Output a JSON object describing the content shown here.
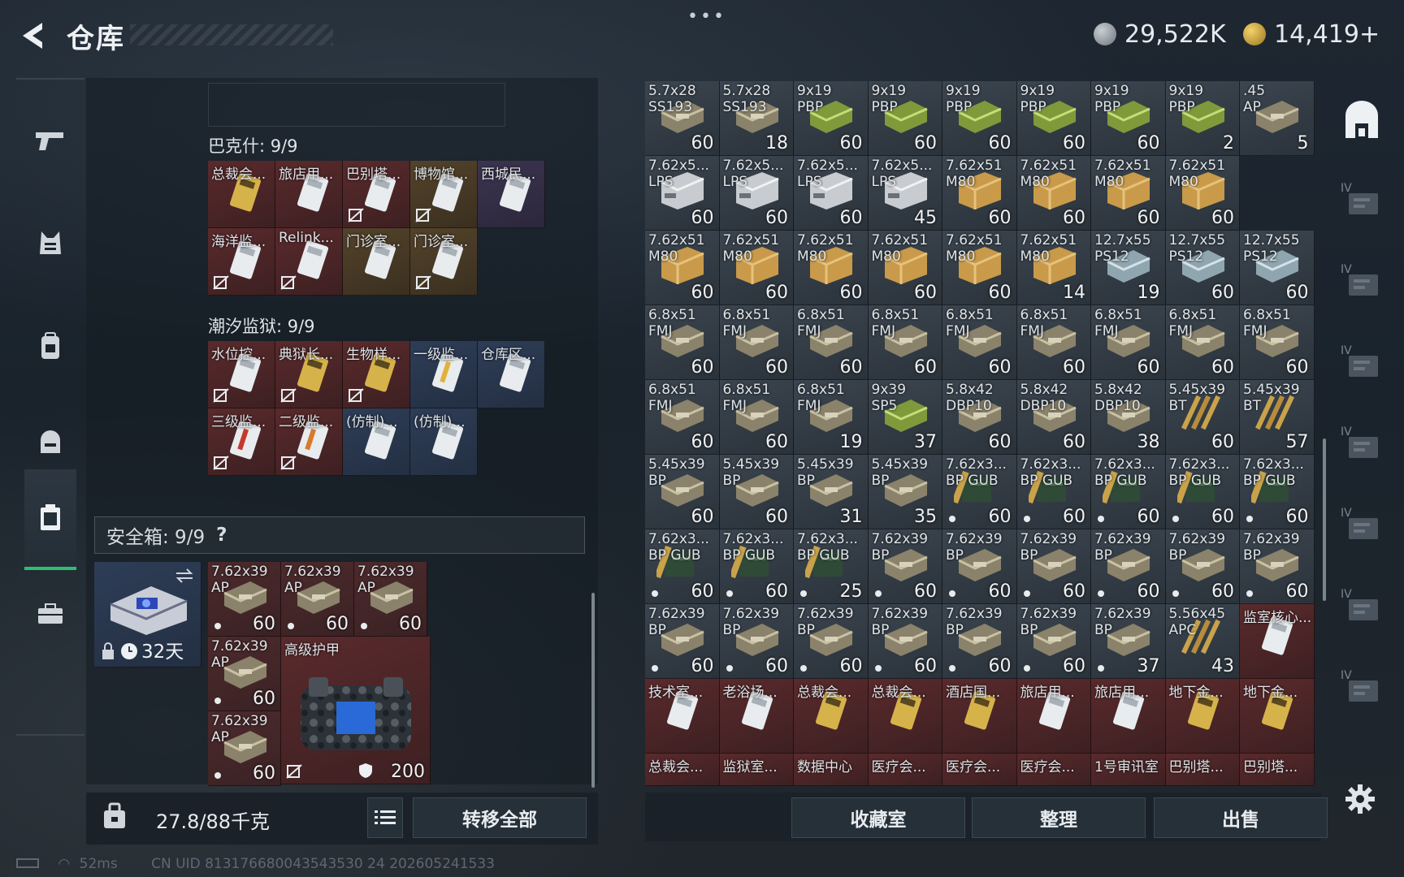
{
  "header": {
    "title": "仓库",
    "more": "•••"
  },
  "currency": {
    "silver": "29,522K",
    "gold": "14,419+"
  },
  "colors": {
    "accent": "#2fbf71",
    "rarity_gray": "#3c4650",
    "rarity_blue": "#2e3d57",
    "rarity_purple": "#3c3450",
    "rarity_red": "#5a2a2c",
    "rarity_orange": "#54432a"
  },
  "sidebar": {
    "items": [
      {
        "icon": "pistol-icon"
      },
      {
        "icon": "armor-vest-icon"
      },
      {
        "icon": "backpack-icon"
      },
      {
        "icon": "helmet-bag-icon"
      },
      {
        "icon": "safe-box-icon",
        "active": true
      },
      {
        "icon": "briefcase-icon"
      }
    ]
  },
  "keyring": {
    "group1": {
      "label": "巴克什: 9/9",
      "items": [
        {
          "name": "总裁会...",
          "rarity": "r",
          "card": "gold",
          "lock": false
        },
        {
          "name": "旅店用...",
          "rarity": "r",
          "card": "white",
          "lock": false
        },
        {
          "name": "巴别塔...",
          "rarity": "r",
          "card": "white",
          "lock": true
        },
        {
          "name": "博物馆...",
          "rarity": "o",
          "card": "white",
          "lock": true
        },
        {
          "name": "西城民...",
          "rarity": "p",
          "card": "white",
          "lock": false
        },
        {
          "name": "海洋监...",
          "rarity": "r",
          "card": "white",
          "lock": true
        },
        {
          "name": "Relink...",
          "rarity": "r",
          "card": "white",
          "lock": true
        },
        {
          "name": "门诊室...",
          "rarity": "o",
          "card": "white",
          "lock": false
        },
        {
          "name": "门诊室...",
          "rarity": "o",
          "card": "white",
          "lock": true
        }
      ]
    },
    "group2": {
      "label": "潮汐监狱: 9/9",
      "items": [
        {
          "name": "水位控...",
          "rarity": "r",
          "card": "white",
          "lock": true
        },
        {
          "name": "典狱长...",
          "rarity": "r",
          "card": "gold",
          "lock": true
        },
        {
          "name": "生物样...",
          "rarity": "r",
          "card": "gold",
          "lock": true
        },
        {
          "name": "一级监...",
          "rarity": "b",
          "card": "yellowbar",
          "lock": false
        },
        {
          "name": "仓库区...",
          "rarity": "b",
          "card": "white",
          "lock": false
        },
        {
          "name": "三级监...",
          "rarity": "r",
          "card": "redbar",
          "lock": true
        },
        {
          "name": "二级监...",
          "rarity": "r",
          "card": "orangebar",
          "lock": true
        },
        {
          "name": "(仿制)...",
          "rarity": "b",
          "card": "white",
          "lock": false
        },
        {
          "name": "(仿制)...",
          "rarity": "b",
          "card": "white",
          "lock": false
        }
      ]
    }
  },
  "safe": {
    "label": "安全箱: 9/9",
    "help": "?",
    "timer": "32天",
    "ammo": [
      {
        "n1": "7.62x39",
        "n2": "AP",
        "q": "60"
      },
      {
        "n1": "7.62x39",
        "n2": "AP",
        "q": "60"
      },
      {
        "n1": "7.62x39",
        "n2": "AP",
        "q": "60"
      },
      {
        "n1": "7.62x39",
        "n2": "AP",
        "q": "60"
      },
      {
        "n1": "7.62x39",
        "n2": "AP",
        "q": "60"
      }
    ],
    "armor": {
      "name": "高级护甲",
      "durability": "200"
    }
  },
  "bottom": {
    "weight": "27.8/88千克",
    "transfer_all": "转移全部",
    "collection": "收藏室",
    "sort": "整理",
    "sell": "出售"
  },
  "footer": {
    "ping": "52ms",
    "uid": "CN UID 813176680043543530 24 202605241533"
  },
  "stash": [
    [
      {
        "n1": "5.7x28",
        "n2": "SS193",
        "q": "60",
        "c": "g",
        "a": "box"
      },
      {
        "n1": "5.7x28",
        "n2": "SS193",
        "q": "18",
        "c": "g",
        "a": "box"
      },
      {
        "n1": "9x19",
        "n2": "PBP",
        "q": "60",
        "c": "g",
        "a": "greenbox"
      },
      {
        "n1": "9x19",
        "n2": "PBP",
        "q": "60",
        "c": "g",
        "a": "greenbox"
      },
      {
        "n1": "9x19",
        "n2": "PBP",
        "q": "60",
        "c": "g",
        "a": "greenbox"
      },
      {
        "n1": "9x19",
        "n2": "PBP",
        "q": "60",
        "c": "g",
        "a": "greenbox"
      },
      {
        "n1": "9x19",
        "n2": "PBP",
        "q": "60",
        "c": "g",
        "a": "greenbox"
      },
      {
        "n1": "9x19",
        "n2": "PBP",
        "q": "2",
        "c": "g",
        "a": "greenbox"
      },
      {
        "n1": ".45",
        "n2": "AP",
        "q": "5",
        "c": "g",
        "a": "box"
      }
    ],
    [
      {
        "n1": "7.62x5...",
        "n2": "LPS",
        "q": "60",
        "c": "g",
        "a": "whitebox"
      },
      {
        "n1": "7.62x5...",
        "n2": "LPS",
        "q": "60",
        "c": "g",
        "a": "whitebox"
      },
      {
        "n1": "7.62x5...",
        "n2": "LPS",
        "q": "60",
        "c": "g",
        "a": "whitebox"
      },
      {
        "n1": "7.62x5...",
        "n2": "LPS",
        "q": "45",
        "c": "g",
        "a": "whitebox"
      },
      {
        "n1": "7.62x51",
        "n2": "M80",
        "q": "60",
        "c": "g",
        "a": "crate"
      },
      {
        "n1": "7.62x51",
        "n2": "M80",
        "q": "60",
        "c": "g",
        "a": "crate"
      },
      {
        "n1": "7.62x51",
        "n2": "M80",
        "q": "60",
        "c": "g",
        "a": "crate"
      },
      {
        "n1": "7.62x51",
        "n2": "M80",
        "q": "60",
        "c": "g",
        "a": "crate"
      }
    ],
    [
      {
        "n1": "7.62x51",
        "n2": "M80",
        "q": "60",
        "c": "g",
        "a": "crate"
      },
      {
        "n1": "7.62x51",
        "n2": "M80",
        "q": "60",
        "c": "g",
        "a": "crate"
      },
      {
        "n1": "7.62x51",
        "n2": "M80",
        "q": "60",
        "c": "g",
        "a": "crate"
      },
      {
        "n1": "7.62x51",
        "n2": "M80",
        "q": "60",
        "c": "g",
        "a": "crate"
      },
      {
        "n1": "7.62x51",
        "n2": "M80",
        "q": "60",
        "c": "g",
        "a": "crate"
      },
      {
        "n1": "7.62x51",
        "n2": "M80",
        "q": "14",
        "c": "g",
        "a": "crate"
      },
      {
        "n1": "12.7x55",
        "n2": "PS12",
        "q": "19",
        "c": "g",
        "a": "bluebox"
      },
      {
        "n1": "12.7x55",
        "n2": "PS12",
        "q": "60",
        "c": "g",
        "a": "bluebox"
      },
      {
        "n1": "12.7x55",
        "n2": "PS12",
        "q": "60",
        "c": "g",
        "a": "bluebox"
      }
    ],
    [
      {
        "n1": "6.8x51",
        "n2": "FMJ",
        "q": "60",
        "c": "g",
        "a": "box"
      },
      {
        "n1": "6.8x51",
        "n2": "FMJ",
        "q": "60",
        "c": "g",
        "a": "box"
      },
      {
        "n1": "6.8x51",
        "n2": "FMJ",
        "q": "60",
        "c": "g",
        "a": "box"
      },
      {
        "n1": "6.8x51",
        "n2": "FMJ",
        "q": "60",
        "c": "g",
        "a": "box"
      },
      {
        "n1": "6.8x51",
        "n2": "FMJ",
        "q": "60",
        "c": "g",
        "a": "box"
      },
      {
        "n1": "6.8x51",
        "n2": "FMJ",
        "q": "60",
        "c": "g",
        "a": "box"
      },
      {
        "n1": "6.8x51",
        "n2": "FMJ",
        "q": "60",
        "c": "g",
        "a": "box"
      },
      {
        "n1": "6.8x51",
        "n2": "FMJ",
        "q": "60",
        "c": "g",
        "a": "box"
      },
      {
        "n1": "6.8x51",
        "n2": "FMJ",
        "q": "60",
        "c": "g",
        "a": "box"
      }
    ],
    [
      {
        "n1": "6.8x51",
        "n2": "FMJ",
        "q": "60",
        "c": "g",
        "a": "box"
      },
      {
        "n1": "6.8x51",
        "n2": "FMJ",
        "q": "60",
        "c": "g",
        "a": "box"
      },
      {
        "n1": "6.8x51",
        "n2": "FMJ",
        "q": "19",
        "c": "g",
        "a": "box"
      },
      {
        "n1": "9x39",
        "n2": "SP5",
        "q": "37",
        "c": "g",
        "a": "greenbox"
      },
      {
        "n1": "5.8x42",
        "n2": "DBP10",
        "q": "60",
        "c": "g",
        "a": "box"
      },
      {
        "n1": "5.8x42",
        "n2": "DBP10",
        "q": "60",
        "c": "g",
        "a": "box"
      },
      {
        "n1": "5.8x42",
        "n2": "DBP10",
        "q": "38",
        "c": "g",
        "a": "box"
      },
      {
        "n1": "5.45x39",
        "n2": "BT",
        "q": "60",
        "c": "g",
        "a": "rounds"
      },
      {
        "n1": "5.45x39",
        "n2": "BT",
        "q": "57",
        "c": "g",
        "a": "rounds"
      }
    ],
    [
      {
        "n1": "5.45x39",
        "n2": "BP",
        "q": "60",
        "c": "g",
        "a": "box"
      },
      {
        "n1": "5.45x39",
        "n2": "BP",
        "q": "60",
        "c": "g",
        "a": "box"
      },
      {
        "n1": "5.45x39",
        "n2": "BP",
        "q": "31",
        "c": "g",
        "a": "box"
      },
      {
        "n1": "5.45x39",
        "n2": "BP",
        "q": "35",
        "c": "g",
        "a": "box"
      },
      {
        "n1": "7.62x3...",
        "n2": "BP GUB",
        "q": "60",
        "c": "g",
        "a": "mag",
        "d": 1
      },
      {
        "n1": "7.62x3...",
        "n2": "BP GUB",
        "q": "60",
        "c": "g",
        "a": "mag",
        "d": 1
      },
      {
        "n1": "7.62x3...",
        "n2": "BP GUB",
        "q": "60",
        "c": "g",
        "a": "mag",
        "d": 1
      },
      {
        "n1": "7.62x3...",
        "n2": "BP GUB",
        "q": "60",
        "c": "g",
        "a": "mag",
        "d": 1
      },
      {
        "n1": "7.62x3...",
        "n2": "BP GUB",
        "q": "60",
        "c": "g",
        "a": "mag",
        "d": 1
      }
    ],
    [
      {
        "n1": "7.62x3...",
        "n2": "BP GUB",
        "q": "60",
        "c": "g",
        "a": "mag",
        "d": 1
      },
      {
        "n1": "7.62x3...",
        "n2": "BP GUB",
        "q": "60",
        "c": "g",
        "a": "mag",
        "d": 1
      },
      {
        "n1": "7.62x3...",
        "n2": "BP GUB",
        "q": "25",
        "c": "g",
        "a": "mag",
        "d": 1
      },
      {
        "n1": "7.62x39",
        "n2": "BP",
        "q": "60",
        "c": "g",
        "a": "box",
        "d": 1
      },
      {
        "n1": "7.62x39",
        "n2": "BP",
        "q": "60",
        "c": "g",
        "a": "box",
        "d": 1
      },
      {
        "n1": "7.62x39",
        "n2": "BP",
        "q": "60",
        "c": "g",
        "a": "box",
        "d": 1
      },
      {
        "n1": "7.62x39",
        "n2": "BP",
        "q": "60",
        "c": "g",
        "a": "box",
        "d": 1
      },
      {
        "n1": "7.62x39",
        "n2": "BP",
        "q": "60",
        "c": "g",
        "a": "box",
        "d": 1
      },
      {
        "n1": "7.62x39",
        "n2": "BP",
        "q": "60",
        "c": "g",
        "a": "box",
        "d": 1
      }
    ],
    [
      {
        "n1": "7.62x39",
        "n2": "BP",
        "q": "60",
        "c": "g",
        "a": "box",
        "d": 1
      },
      {
        "n1": "7.62x39",
        "n2": "BP",
        "q": "60",
        "c": "g",
        "a": "box",
        "d": 1
      },
      {
        "n1": "7.62x39",
        "n2": "BP",
        "q": "60",
        "c": "g",
        "a": "box",
        "d": 1
      },
      {
        "n1": "7.62x39",
        "n2": "BP",
        "q": "60",
        "c": "g",
        "a": "box",
        "d": 1
      },
      {
        "n1": "7.62x39",
        "n2": "BP",
        "q": "60",
        "c": "g",
        "a": "box",
        "d": 1
      },
      {
        "n1": "7.62x39",
        "n2": "BP",
        "q": "60",
        "c": "g",
        "a": "box",
        "d": 1
      },
      {
        "n1": "7.62x39",
        "n2": "BP",
        "q": "37",
        "c": "g",
        "a": "box",
        "d": 1
      },
      {
        "n1": "5.56x45",
        "n2": "APC",
        "q": "43",
        "c": "g",
        "a": "rounds"
      },
      {
        "n1": "监室核心...",
        "n2": "",
        "q": "",
        "c": "r",
        "a": "card"
      }
    ],
    [
      {
        "n1": "技术室...",
        "n2": "",
        "q": "",
        "c": "r",
        "a": "card"
      },
      {
        "n1": "老浴场...",
        "n2": "",
        "q": "",
        "c": "r",
        "a": "card"
      },
      {
        "n1": "总裁会...",
        "n2": "",
        "q": "",
        "c": "r",
        "a": "goldcard"
      },
      {
        "n1": "总裁会...",
        "n2": "",
        "q": "",
        "c": "r",
        "a": "goldcard"
      },
      {
        "n1": "酒店国...",
        "n2": "",
        "q": "",
        "c": "r",
        "a": "goldcard"
      },
      {
        "n1": "旅店用...",
        "n2": "",
        "q": "",
        "c": "r",
        "a": "card"
      },
      {
        "n1": "旅店用...",
        "n2": "",
        "q": "",
        "c": "r",
        "a": "card"
      },
      {
        "n1": "地下金...",
        "n2": "",
        "q": "",
        "c": "r",
        "a": "goldcard"
      },
      {
        "n1": "地下金...",
        "n2": "",
        "q": "",
        "c": "r",
        "a": "goldcard"
      }
    ],
    [
      {
        "n1": "总裁会...",
        "n2": "",
        "q": "",
        "c": "r",
        "a": "card"
      },
      {
        "n1": "监狱室...",
        "n2": "",
        "q": "",
        "c": "r",
        "a": "card"
      },
      {
        "n1": "数据中心",
        "n2": "",
        "q": "",
        "c": "r",
        "a": "card"
      },
      {
        "n1": "医疗会...",
        "n2": "",
        "q": "",
        "c": "r",
        "a": "card"
      },
      {
        "n1": "医疗会...",
        "n2": "",
        "q": "",
        "c": "r",
        "a": "card"
      },
      {
        "n1": "医疗会...",
        "n2": "",
        "q": "",
        "c": "r",
        "a": "card"
      },
      {
        "n1": "1号审讯室",
        "n2": "",
        "q": "",
        "c": "r",
        "a": "card"
      },
      {
        "n1": "巴别塔...",
        "n2": "",
        "q": "",
        "c": "r",
        "a": "card"
      },
      {
        "n1": "巴别塔...",
        "n2": "",
        "q": "",
        "c": "r",
        "a": "card"
      }
    ]
  ],
  "right_nav": {
    "items": [
      {
        "icon": "home-vault-icon",
        "label": ""
      },
      {
        "icon": "stash-tab-1-icon",
        "label": "IV"
      },
      {
        "icon": "stash-tab-2-icon",
        "label": "IV"
      },
      {
        "icon": "stash-tab-3-icon",
        "label": "IV"
      },
      {
        "icon": "stash-tab-4-icon",
        "label": "IV"
      },
      {
        "icon": "stash-tab-5-icon",
        "label": "IV"
      },
      {
        "icon": "stash-tab-6-icon",
        "label": "IV"
      },
      {
        "icon": "stash-tab-add-icon",
        "label": "IV"
      }
    ]
  }
}
